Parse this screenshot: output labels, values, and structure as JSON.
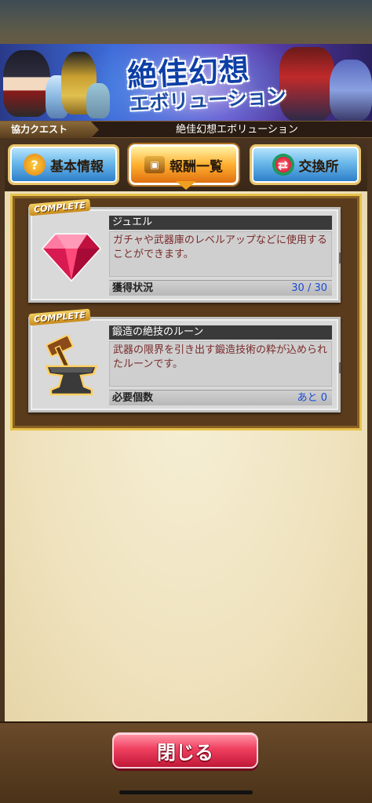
{
  "banner": {
    "title_main": "絶佳幻想",
    "title_sub": "エボリューション"
  },
  "subheader": {
    "tag": "協力クエスト",
    "quest_name": "絶佳幻想エボリューション"
  },
  "tabs": [
    {
      "label": "基本情報",
      "icon": "question-icon",
      "active": false
    },
    {
      "label": "報酬一覧",
      "icon": "treasure-chest-icon",
      "active": true
    },
    {
      "label": "交換所",
      "icon": "exchange-icon",
      "active": false
    }
  ],
  "rewards": [
    {
      "badge": "COMPLETE",
      "name": "ジュエル",
      "description": "ガチャや武器庫のレベルアップなどに使用することができます。",
      "status_label": "獲得状況",
      "status_value": "30 / 30",
      "icon": "jewel-icon"
    },
    {
      "badge": "COMPLETE",
      "name": "鍛造の絶技のルーン",
      "description": "武器の限界を引き出す鍛造技術の粋が込められたルーンです。",
      "status_label": "必要個数",
      "status_value": "あと 0",
      "icon": "anvil-rune-icon"
    }
  ],
  "footer": {
    "close_label": "閉じる"
  },
  "colors": {
    "accent_gold": "#e6c24a",
    "close_button": "#f04060",
    "status_value": "#1a4ad8"
  }
}
